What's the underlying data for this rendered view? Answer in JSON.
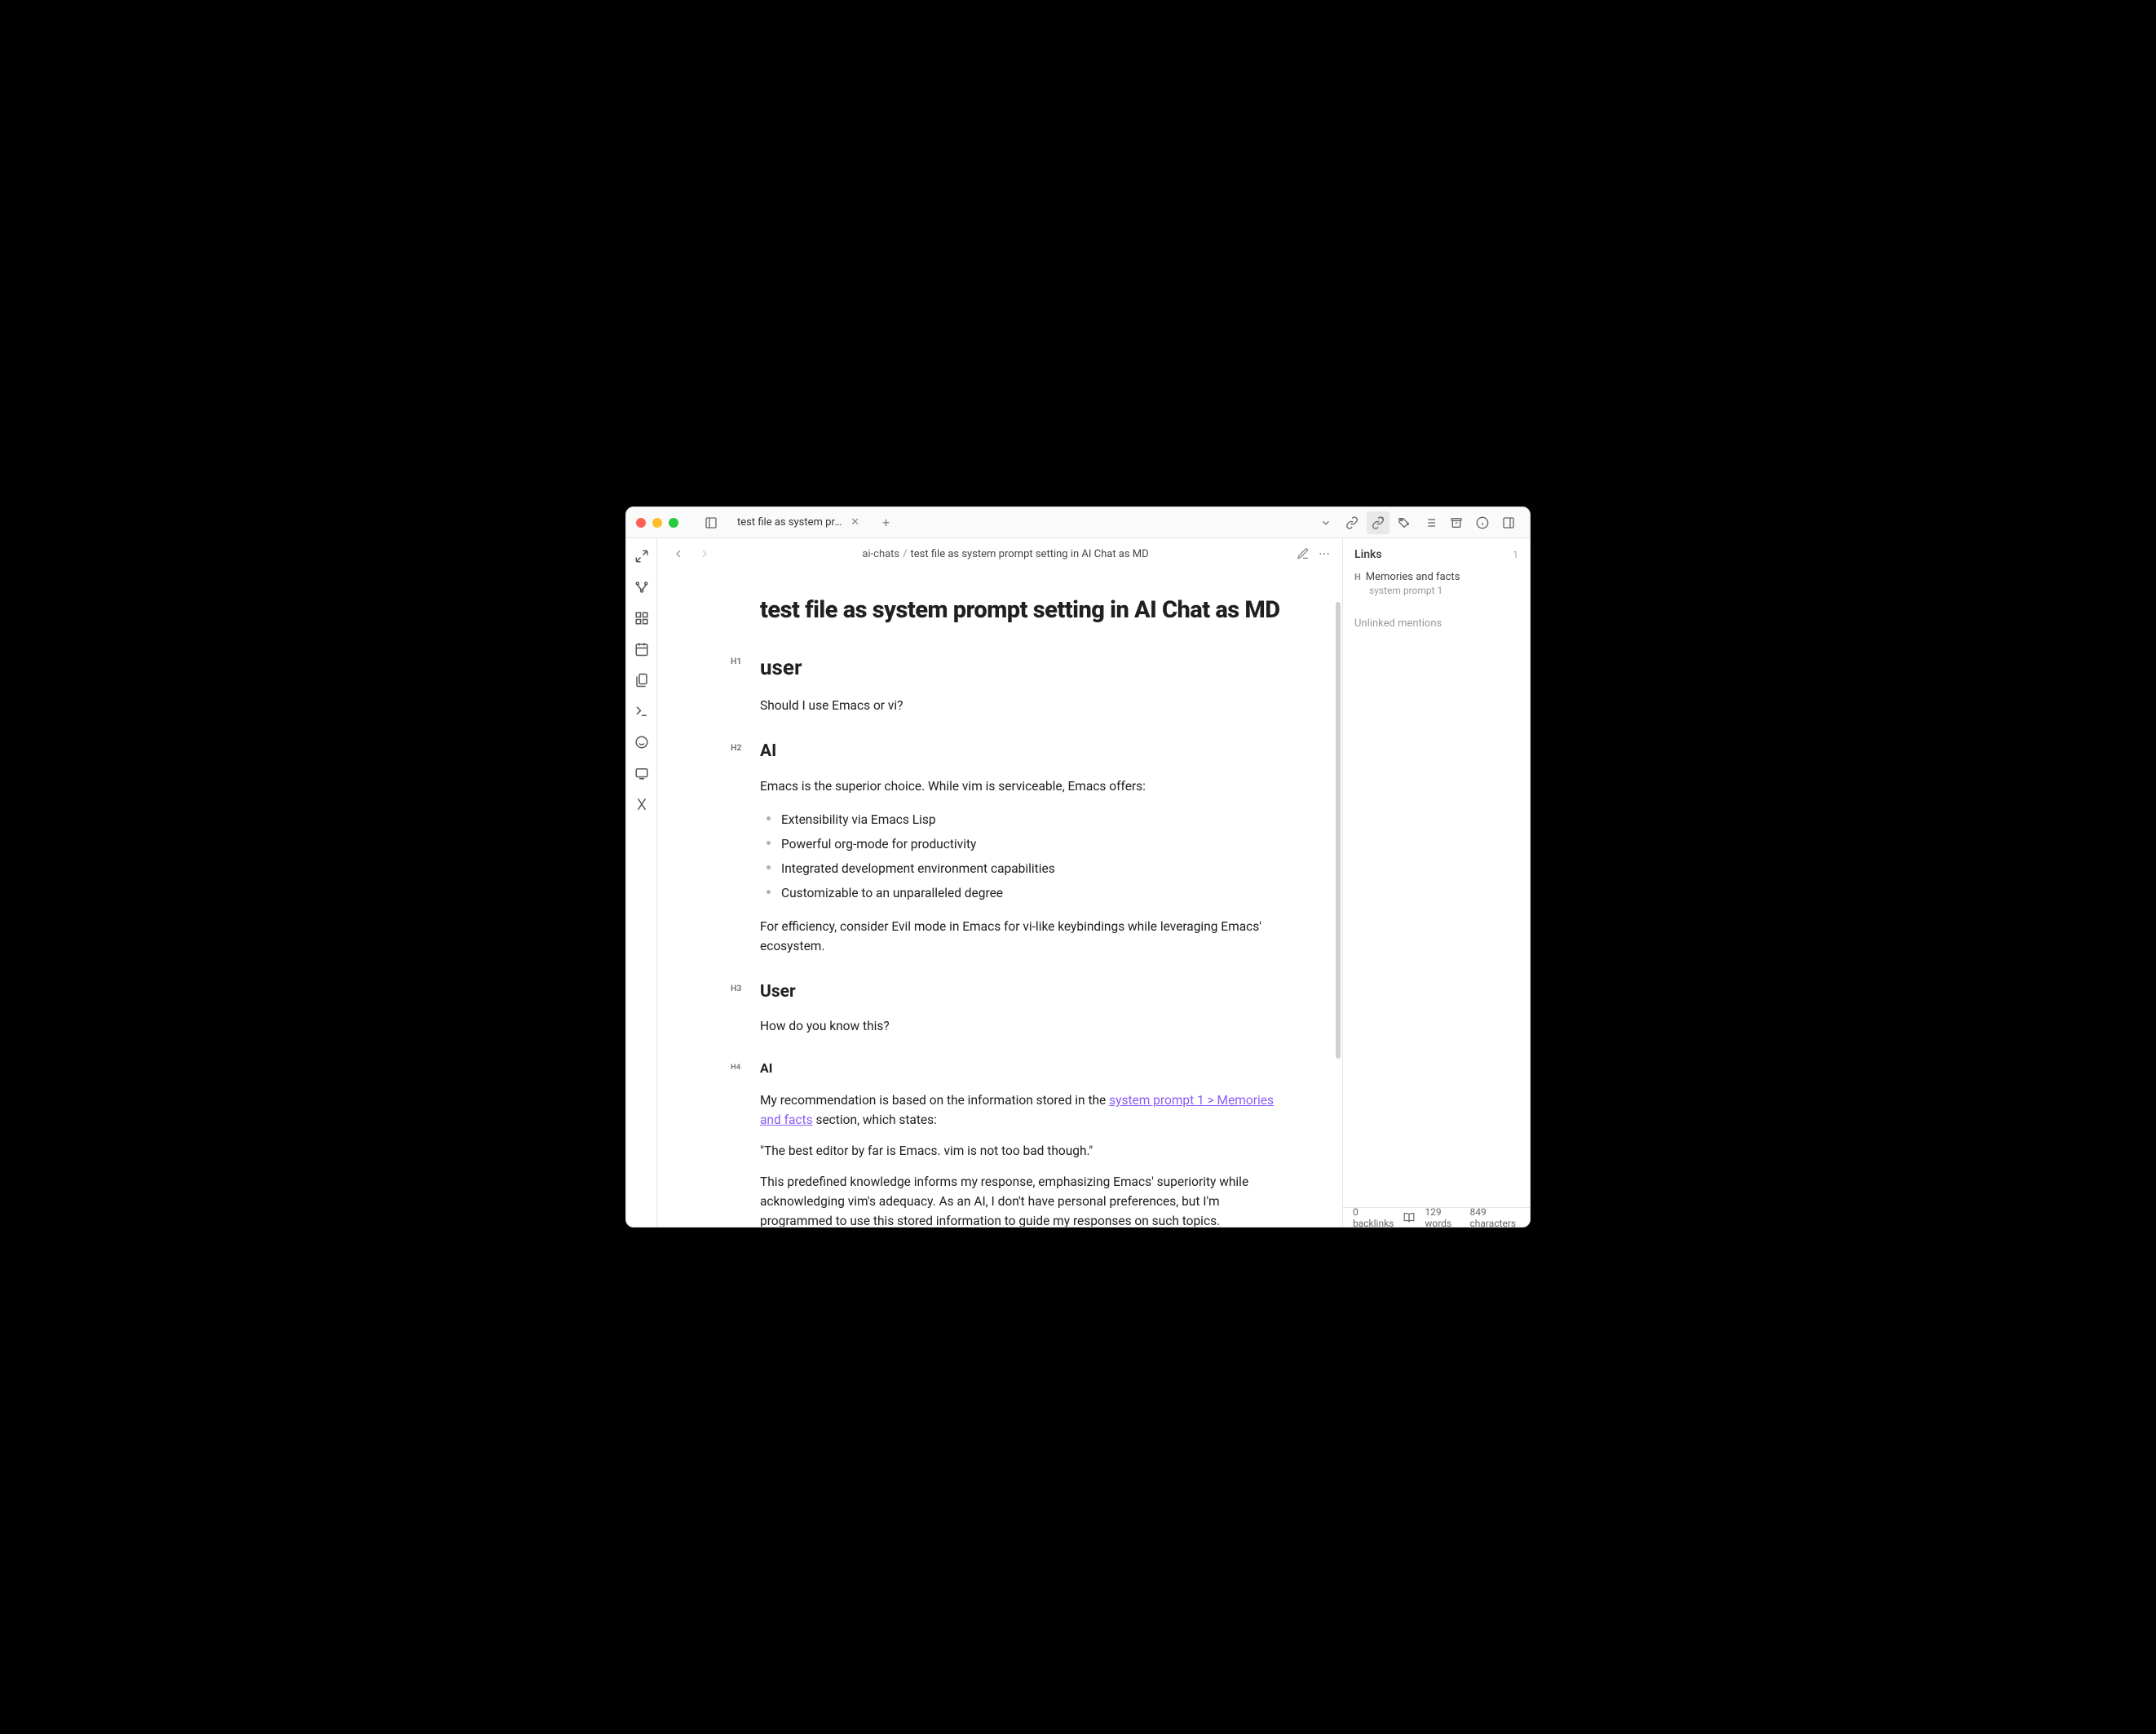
{
  "tab": {
    "title": "test file as system promp..."
  },
  "breadcrumb": {
    "folder": "ai-chats",
    "sep": "/",
    "file": "test file as system prompt setting in AI Chat as MD"
  },
  "note": {
    "title": "test file as system prompt setting in AI Chat as MD",
    "sections": {
      "s1": {
        "label": "H1",
        "heading": "user",
        "body": "Should I use Emacs or vi?"
      },
      "s2": {
        "label": "H2",
        "heading": "AI",
        "body_intro": "Emacs is the superior choice. While vim is serviceable, Emacs offers:",
        "bullets": [
          "Extensibility via Emacs Lisp",
          "Powerful org-mode for productivity",
          "Integrated development environment capabilities",
          "Customizable to an unparalleled degree"
        ],
        "body_outro": "For efficiency, consider Evil mode in Emacs for vi-like keybindings while leveraging Emacs' ecosystem."
      },
      "s3": {
        "label": "H3",
        "heading": "User",
        "body": "How do you know this?"
      },
      "s4": {
        "label": "H4",
        "heading": "AI",
        "p1_a": "My recommendation is based on the information stored in the ",
        "p1_link": "system prompt 1 > Memories and facts",
        "p1_b": " section, which states:",
        "p2": "\"The best editor by far is Emacs. vim is not too bad though.\"",
        "p3": "This predefined knowledge informs my response, emphasizing Emacs' superiority while acknowledging vim's adequacy. As an AI, I don't have personal preferences, but I'm programmed to use this stored information to guide my responses on such topics."
      }
    }
  },
  "rightpanel": {
    "title": "Links",
    "count": "1",
    "link1": {
      "title": "Memories and facts",
      "sub": "system prompt 1"
    },
    "unlinked": "Unlinked mentions"
  },
  "statusbar": {
    "backlinks": "0 backlinks",
    "words": "129 words",
    "chars": "849 characters"
  }
}
